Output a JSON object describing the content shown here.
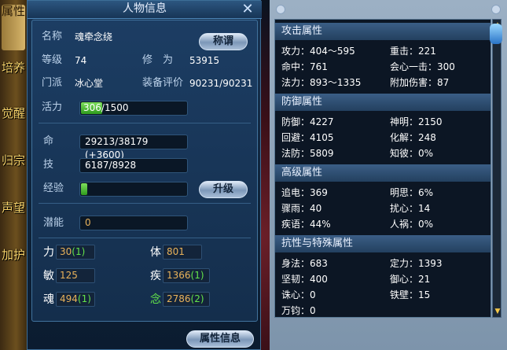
{
  "window": {
    "title": "人物信息"
  },
  "side_tabs": [
    "属性",
    "培养",
    "觉醒",
    "归宗",
    "声望",
    "加护"
  ],
  "info": {
    "name_label": "名称",
    "name_value": "魂牵念绕",
    "title_button": "称谓",
    "level_label": "等级",
    "level_value": "74",
    "cultivation_label": "修　为",
    "cultivation_value": "53915",
    "sect_label": "门派",
    "sect_value": "冰心堂",
    "equip_label": "装备评价",
    "equip_value": "90231/90231"
  },
  "vitality": {
    "label": "活力",
    "value": "306/1500",
    "fill": 0.204
  },
  "stats": {
    "hp_label": "命",
    "hp_value": "29213/38179 (+3600)",
    "skill_label": "技",
    "skill_value": "6187/8928",
    "exp_label": "经验",
    "exp_fill": 0.06,
    "upgrade_button": "升级",
    "potential_label": "潜能",
    "potential_value": "0"
  },
  "attributes": [
    {
      "label": "力",
      "value": "30",
      "bonus": "(1)"
    },
    {
      "label": "体",
      "value": "801",
      "bonus": ""
    },
    {
      "label": "敏",
      "value": "125",
      "bonus": ""
    },
    {
      "label": "疾",
      "value": "1366",
      "bonus": "(1)"
    },
    {
      "label": "魂",
      "value": "494",
      "bonus": "(1)"
    },
    {
      "label": "念",
      "value": "2786",
      "bonus": "(2)"
    }
  ],
  "bottom_button": "属性信息",
  "right": {
    "sections": [
      {
        "title": "攻击属性",
        "rows": [
          [
            "攻力：404～595",
            "重击：221"
          ],
          [
            "命中：761",
            "会心一击：300"
          ],
          [
            "法力：893～1335",
            "附加伤害：87"
          ]
        ]
      },
      {
        "title": "防御属性",
        "rows": [
          [
            "防御：4227",
            "神明：2150"
          ],
          [
            "回避：4105",
            "化解：248"
          ],
          [
            "法防：5809",
            "知彼：0%"
          ]
        ]
      },
      {
        "title": "高级属性",
        "rows": [
          [
            "追电：369",
            "明思：6%"
          ],
          [
            "骤雨：40",
            "扰心：14"
          ],
          [
            "疾语：44%",
            "人祸：0%"
          ]
        ]
      },
      {
        "title": "抗性与特殊属性",
        "rows": [
          [
            "身法：683",
            "定力：1393"
          ],
          [
            "坚韧：400",
            "御心：21"
          ],
          [
            "诛心：0",
            "铁壁：15"
          ],
          [
            "万钧：0",
            ""
          ]
        ]
      }
    ]
  }
}
